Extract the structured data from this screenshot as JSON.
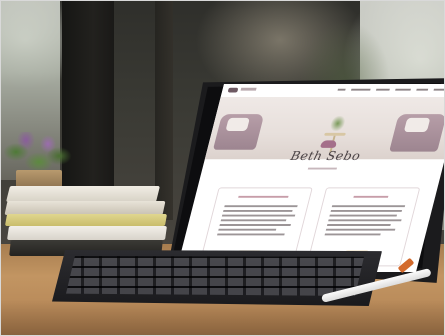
{
  "scene": {
    "subject": "tablet-with-keyboard-on-desk",
    "colors": {
      "desk": "#b8875a",
      "tablet": "#1b1b1d",
      "accent_pink": "#a46f8a",
      "button_cream": "#efe2c6"
    }
  },
  "website": {
    "brand_name": "Beth Sebo",
    "nav_items_count": 6,
    "cards_count": 2
  }
}
